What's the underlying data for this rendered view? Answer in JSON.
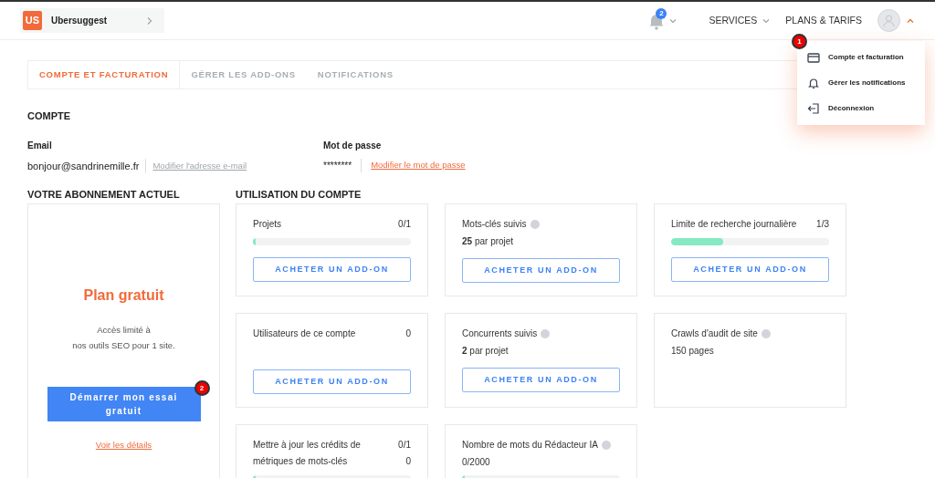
{
  "header": {
    "logo": "US",
    "project": "Ubersuggest",
    "notification_count": "2",
    "nav": [
      "SERVICES",
      "PLANS & TARIFS"
    ]
  },
  "user_menu": {
    "open": true,
    "marker": "1",
    "items": [
      {
        "kind": "card",
        "label": "Compte et facturation"
      },
      {
        "kind": "bell",
        "label": "Gérer les notifications"
      },
      {
        "kind": "logout",
        "label": "Déconnexion"
      }
    ]
  },
  "tabs": [
    {
      "label": "COMPTE ET FACTURATION",
      "selected": true
    },
    {
      "label": "GÉRER LES ADD-ONS",
      "selected": false
    },
    {
      "label": "NOTIFICATIONS",
      "selected": false
    }
  ],
  "account": {
    "title": "COMPTE",
    "email_label": "Email",
    "email": "bonjour@sandrinemille.fr",
    "email_link": "Modifier l'adresse e-mail",
    "password_label": "Mot de passe",
    "password": "********",
    "password_link": "Modifier le mot de passe"
  },
  "subscription": {
    "title": "VOTRE ABONNEMENT ACTUEL",
    "plan": "Plan gratuit",
    "description": [
      "Accès limité à",
      "nos outils SEO pour 1 site."
    ],
    "button": "Démarrer mon essai gratuit",
    "marker": "2",
    "link": "Voir les détails"
  },
  "usage": {
    "title": "UTILISATION DU COMPTE",
    "cards": [
      {
        "label": "Projets",
        "help": false,
        "counts": [
          "0/1"
        ],
        "level": 0,
        "button": "ACHETER UN ADD-ON"
      },
      {
        "label": "Mots-clés suivis",
        "help": true,
        "value": "**25** par projet",
        "button": "ACHETER UN ADD-ON"
      },
      {
        "label": "Limite de recherche journalière",
        "help": false,
        "counts": [
          "1/3"
        ],
        "level": 0.33,
        "button": "ACHETER UN ADD-ON"
      },
      {
        "label": "Utilisateurs de ce compte",
        "help": false,
        "counts": [
          "0"
        ],
        "button": "ACHETER UN ADD-ON"
      },
      {
        "label": "Concurrents suivis",
        "help": true,
        "value": "**2** par projet",
        "button": "ACHETER UN ADD-ON"
      },
      {
        "label": "Crawls d'audit de site",
        "help": true,
        "value": "150 pages"
      },
      {
        "label": "Mettre à jour les crédits de métriques de mots-clés",
        "help": false,
        "counts": [
          "0/1",
          "0"
        ],
        "level": 0
      },
      {
        "label": "Nombre de mots du Rédacteur IA",
        "help": true,
        "value": "0/2000",
        "level": 0
      }
    ]
  }
}
